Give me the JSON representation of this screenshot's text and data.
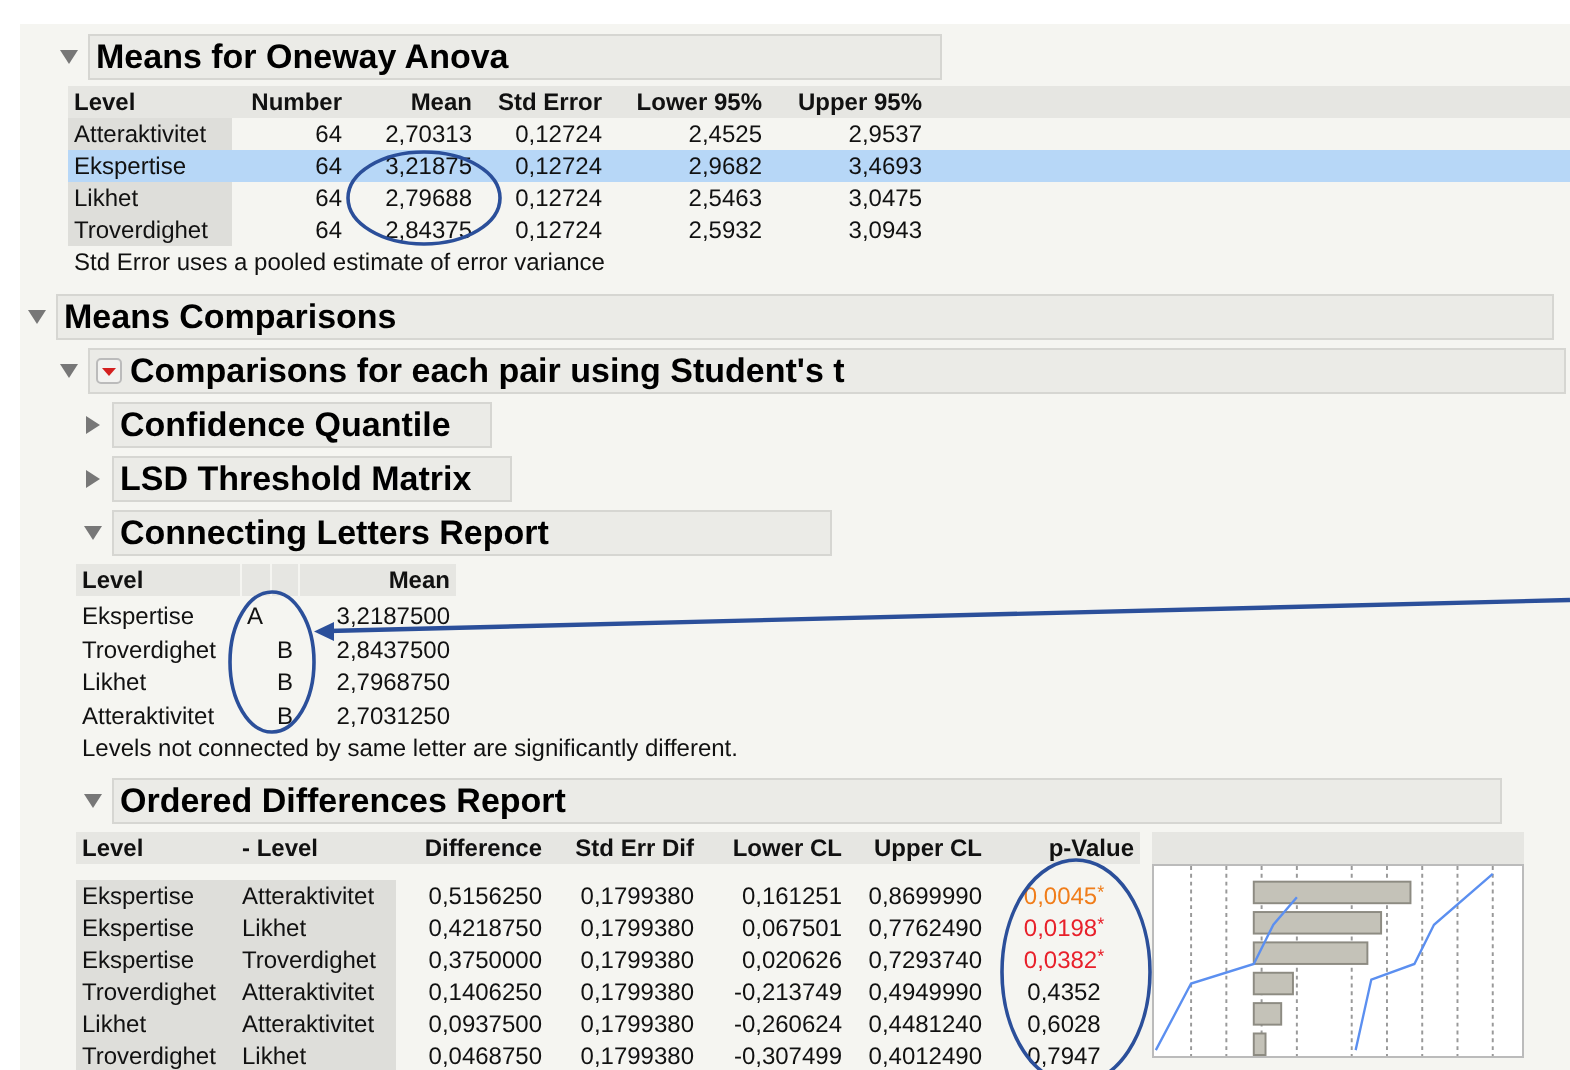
{
  "means_for_oneway_anova": {
    "title": "Means for Oneway Anova",
    "expanded": true,
    "columns": [
      "Level",
      "Number",
      "Mean",
      "Std Error",
      "Lower 95%",
      "Upper 95%"
    ],
    "rows": [
      {
        "level": "Atteraktivitet",
        "number": "64",
        "mean": "2,70313",
        "std_error": "0,12724",
        "lower_95": "2,4525",
        "upper_95": "2,9537",
        "selected": false
      },
      {
        "level": "Ekspertise",
        "number": "64",
        "mean": "3,21875",
        "std_error": "0,12724",
        "lower_95": "2,9682",
        "upper_95": "3,4693",
        "selected": true
      },
      {
        "level": "Likhet",
        "number": "64",
        "mean": "2,79688",
        "std_error": "0,12724",
        "lower_95": "2,5463",
        "upper_95": "3,0475",
        "selected": false
      },
      {
        "level": "Troverdighet",
        "number": "64",
        "mean": "2,84375",
        "std_error": "0,12724",
        "lower_95": "2,5932",
        "upper_95": "3,0943",
        "selected": false
      }
    ],
    "note": "Std Error uses a pooled estimate of error variance"
  },
  "means_comparisons": {
    "title": "Means Comparisons",
    "expanded": true,
    "pair_comparison": {
      "title": "Comparisons for each pair using Student's t",
      "expanded": true,
      "sections": [
        {
          "title": "Confidence Quantile",
          "expanded": false
        },
        {
          "title": "LSD Threshold Matrix",
          "expanded": false
        }
      ],
      "connecting_letters": {
        "title": "Connecting Letters Report",
        "expanded": true,
        "columns": [
          "Level",
          "Mean"
        ],
        "rows": [
          {
            "level": "Ekspertise",
            "column_1": "A",
            "mean": "3,2187500"
          },
          {
            "level": "Troverdighet",
            "column_2": "B",
            "mean": "2,8437500"
          },
          {
            "level": "Likhet",
            "column_2": "B",
            "mean": "2,7968750"
          },
          {
            "level": "Atteraktivitet",
            "column_2": "B",
            "mean": "2,7031250"
          }
        ],
        "note": "Levels not connected by same letter are significantly different."
      },
      "ordered_differences": {
        "title": "Ordered Differences Report",
        "expanded": true,
        "columns": [
          "Level",
          "- Level",
          "Difference",
          "Std Err Dif",
          "Lower CL",
          "Upper CL",
          "p-Value"
        ],
        "rows": [
          {
            "level": "Ekspertise",
            "minus_level": "Atteraktivitet",
            "difference": "0,5156250",
            "std_err_dif": "0,1799380",
            "lower_cl": "0,161251",
            "upper_cl": "0,8699990",
            "p_value": "0,0045",
            "flag": "*",
            "color": "#f07d1a"
          },
          {
            "level": "Ekspertise",
            "minus_level": "Likhet",
            "difference": "0,4218750",
            "std_err_dif": "0,1799380",
            "lower_cl": "0,067501",
            "upper_cl": "0,7762490",
            "p_value": "0,0198",
            "flag": "*",
            "color": "#e8202a"
          },
          {
            "level": "Ekspertise",
            "minus_level": "Troverdighet",
            "difference": "0,3750000",
            "std_err_dif": "0,1799380",
            "lower_cl": "0,020626",
            "upper_cl": "0,7293740",
            "p_value": "0,0382",
            "flag": "*",
            "color": "#e8202a"
          },
          {
            "level": "Troverdighet",
            "minus_level": "Atteraktivitet",
            "difference": "0,1406250",
            "std_err_dif": "0,1799380",
            "lower_cl": "-0,213749",
            "upper_cl": "0,4949990",
            "p_value": "0,4352",
            "color": "#111111"
          },
          {
            "level": "Likhet",
            "minus_level": "Atteraktivitet",
            "difference": "0,0937500",
            "std_err_dif": "0,1799380",
            "lower_cl": "-0,260624",
            "upper_cl": "0,4481240",
            "p_value": "0,6028",
            "color": "#111111"
          },
          {
            "level": "Troverdighet",
            "minus_level": "Likhet",
            "difference": "0,0468750",
            "std_err_dif": "0,1799380",
            "lower_cl": "-0,307499",
            "upper_cl": "0,4012490",
            "p_value": "0,7947",
            "color": "#111111"
          }
        ]
      }
    }
  }
}
